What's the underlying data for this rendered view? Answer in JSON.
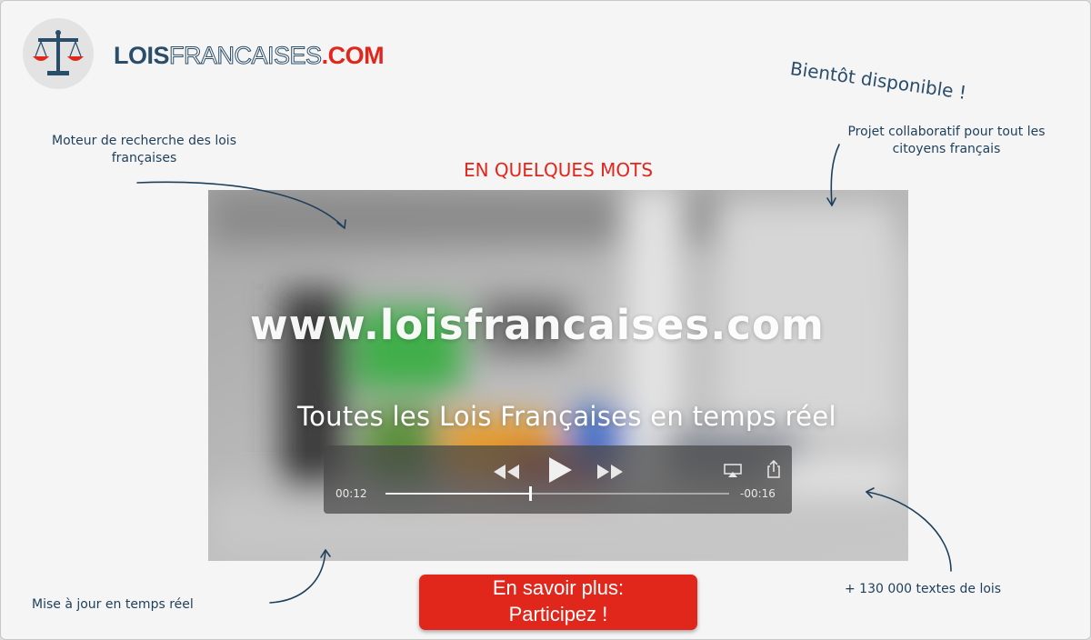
{
  "header": {
    "logo_icon": "scales-of-justice-icon",
    "brand_part1": "LOIS",
    "brand_part2": "FRANCAISES",
    "brand_part3": ".COM",
    "soon_text": "Bientôt disponible !"
  },
  "notes": {
    "search_engine": "Moteur de recherche des lois françaises",
    "collaborative": "Projet collaboratif pour tout les citoyens français",
    "realtime": "Mise à jour en temps réel",
    "texts_count": "+ 130 000 textes de lois"
  },
  "section_title": "EN QUELQUES MOTS",
  "video": {
    "url_text": "www.loisfrancaises.com",
    "tagline": "Toutes les Lois Françaises en temps réel",
    "elapsed": "00:12",
    "remaining": "-00:16",
    "progress": 0.42,
    "controls": {
      "rewind_icon": "rewind-icon",
      "play_icon": "play-icon",
      "forward_icon": "fast-forward-icon",
      "airplay_icon": "airplay-icon",
      "share_icon": "share-icon"
    }
  },
  "cta": {
    "line1": "En savoir plus:",
    "line2": "Participez !"
  },
  "colors": {
    "brand_blue": "#2a4d69",
    "brand_red": "#e1261c",
    "background": "#f5f5f5"
  }
}
